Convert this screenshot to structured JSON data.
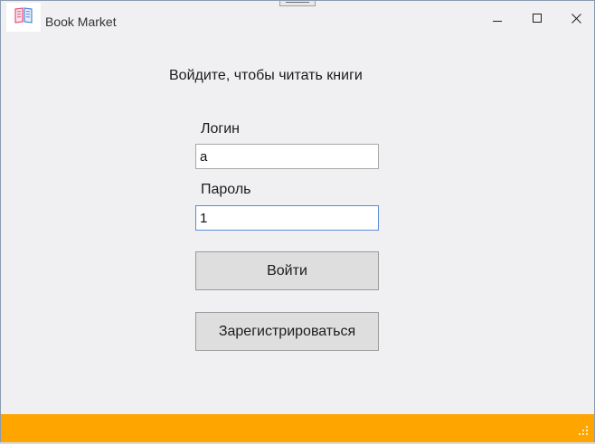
{
  "window": {
    "title": "Book Market",
    "icon": "book-icon",
    "controls": [
      "minimize-icon",
      "maximize-icon",
      "close-icon"
    ]
  },
  "login_form": {
    "prompt": "Войдите, чтобы читать книги",
    "login_label": "Логин",
    "login_value": "a",
    "password_label": "Пароль",
    "password_value": "1",
    "submit_label": "Войти",
    "register_label": "Зарегистрироваться"
  },
  "colors": {
    "background": "#f0eff2",
    "status_bar": "#ffa500",
    "focused_border": "#5b8dd6",
    "button_bg": "#dedede"
  }
}
